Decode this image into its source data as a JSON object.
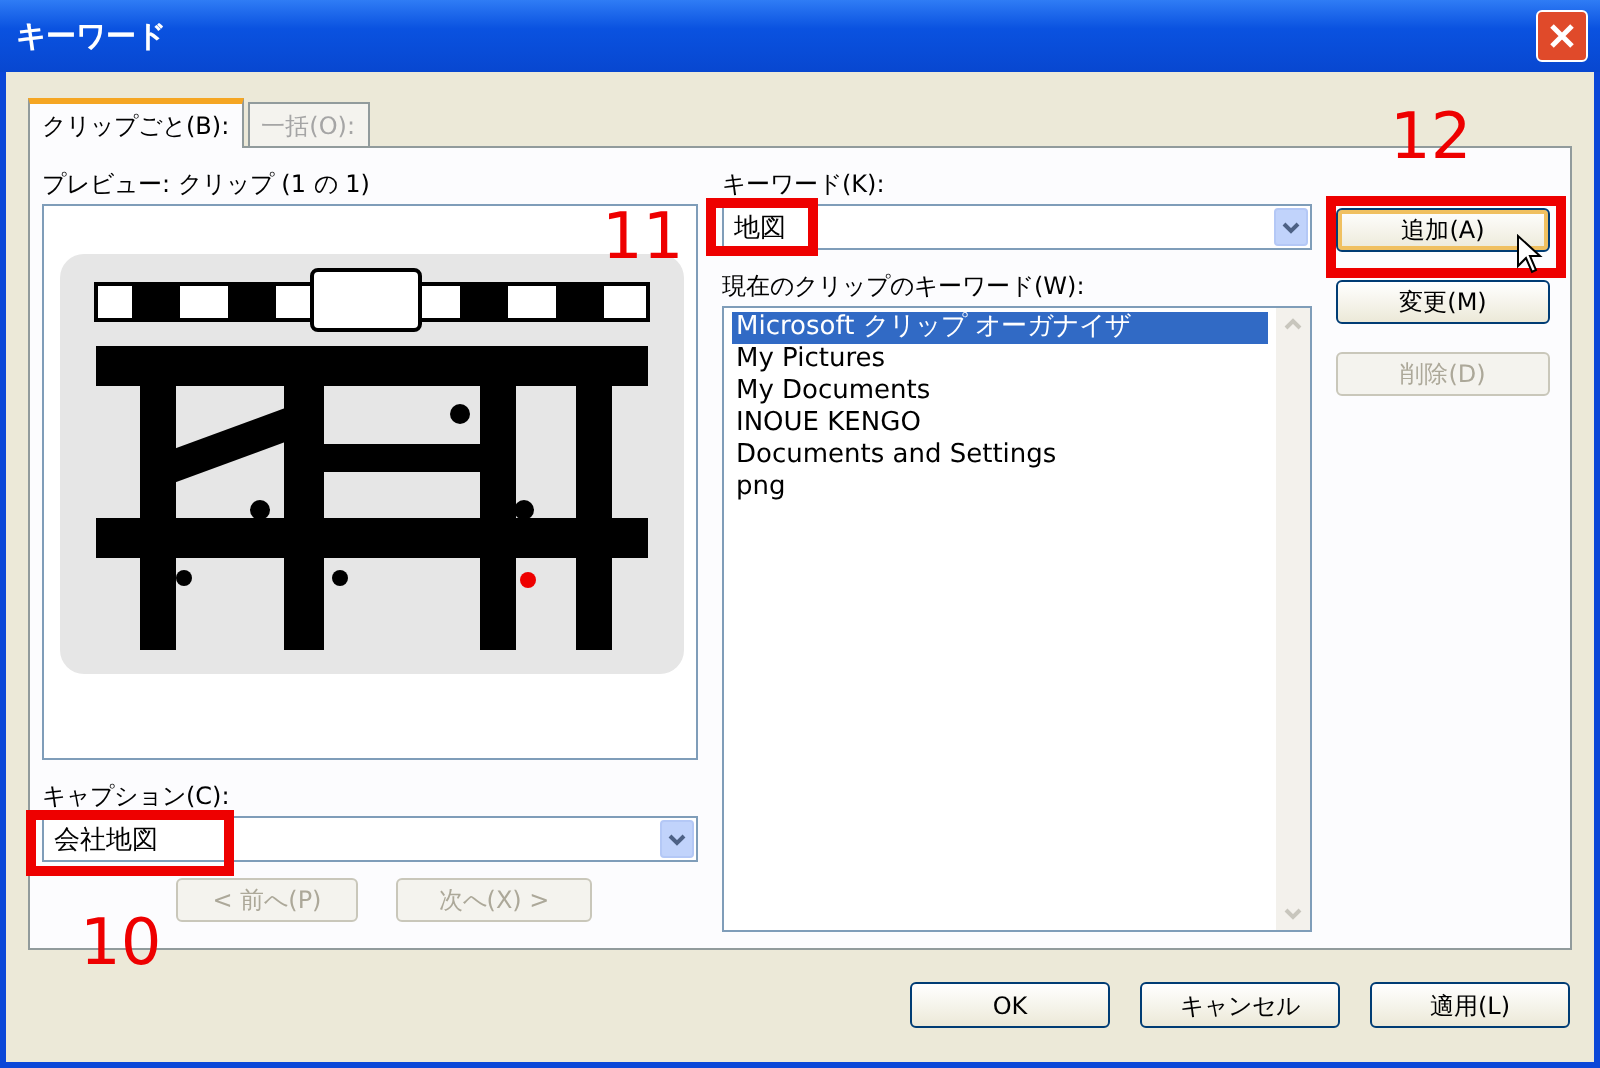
{
  "window": {
    "title": "キーワード"
  },
  "tabs": [
    {
      "label": "クリップごと(B):",
      "selected": true,
      "disabled": false
    },
    {
      "label": "一括(O):",
      "selected": false,
      "disabled": true
    }
  ],
  "preview": {
    "label": "プレビュー:  クリップ (1 の 1)",
    "kind": "picture"
  },
  "caption": {
    "label": "キャプション(C):",
    "value": "会社地図",
    "annotation": "10"
  },
  "nav_buttons": [
    {
      "label": "< 前へ(P)",
      "disabled": true
    },
    {
      "label": "次へ(X) >",
      "disabled": true
    }
  ],
  "keyword": {
    "label": "キーワード(K):",
    "value": "地図",
    "annotation": "11"
  },
  "current_keywords": {
    "label": "現在のクリップのキーワード(W):",
    "items": [
      {
        "text": "Microsoft クリップ オーガナイザ",
        "selected": true
      },
      {
        "text": "My Pictures",
        "selected": false
      },
      {
        "text": "My Documents",
        "selected": false
      },
      {
        "text": "INOUE KENGO",
        "selected": false
      },
      {
        "text": "Documents and Settings",
        "selected": false
      },
      {
        "text": "png",
        "selected": false
      }
    ]
  },
  "side_buttons": [
    {
      "label": "追加(A)",
      "disabled": false,
      "annotation": "12"
    },
    {
      "label": "変更(M)",
      "disabled": false
    },
    {
      "label": "削除(D)",
      "disabled": true
    }
  ],
  "footer_buttons": [
    {
      "label": "OK"
    },
    {
      "label": "キャンセル"
    },
    {
      "label": "適用(L)"
    }
  ]
}
